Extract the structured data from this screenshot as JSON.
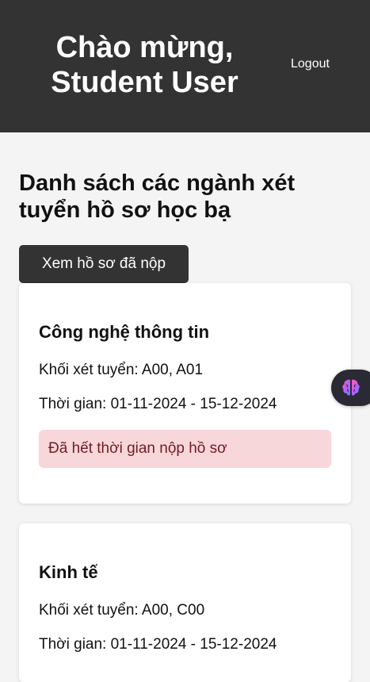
{
  "header": {
    "welcome": "Chào mừng, Student User",
    "logout_label": "Logout"
  },
  "main": {
    "title": "Danh sách các ngành xét tuyển hồ sơ học bạ",
    "view_submitted_label": "Xem hồ sơ đã nộp",
    "majors": [
      {
        "name": "Công nghệ thông tin",
        "blocks": "Khối xét tuyển: A00, A01",
        "period": "Thời gian: 01-11-2024 - 15-12-2024",
        "status": "Đã hết thời gian nộp hồ sơ"
      },
      {
        "name": "Kinh tế",
        "blocks": "Khối xét tuyển: A00, C00",
        "period": "Thời gian: 01-11-2024 - 15-12-2024"
      }
    ]
  },
  "floating_widget": {
    "icon": "brain-icon"
  },
  "colors": {
    "header_bg": "#333333",
    "page_bg": "#f4f4f4",
    "alert_bg": "#f8d7da",
    "alert_text": "#721c24"
  }
}
